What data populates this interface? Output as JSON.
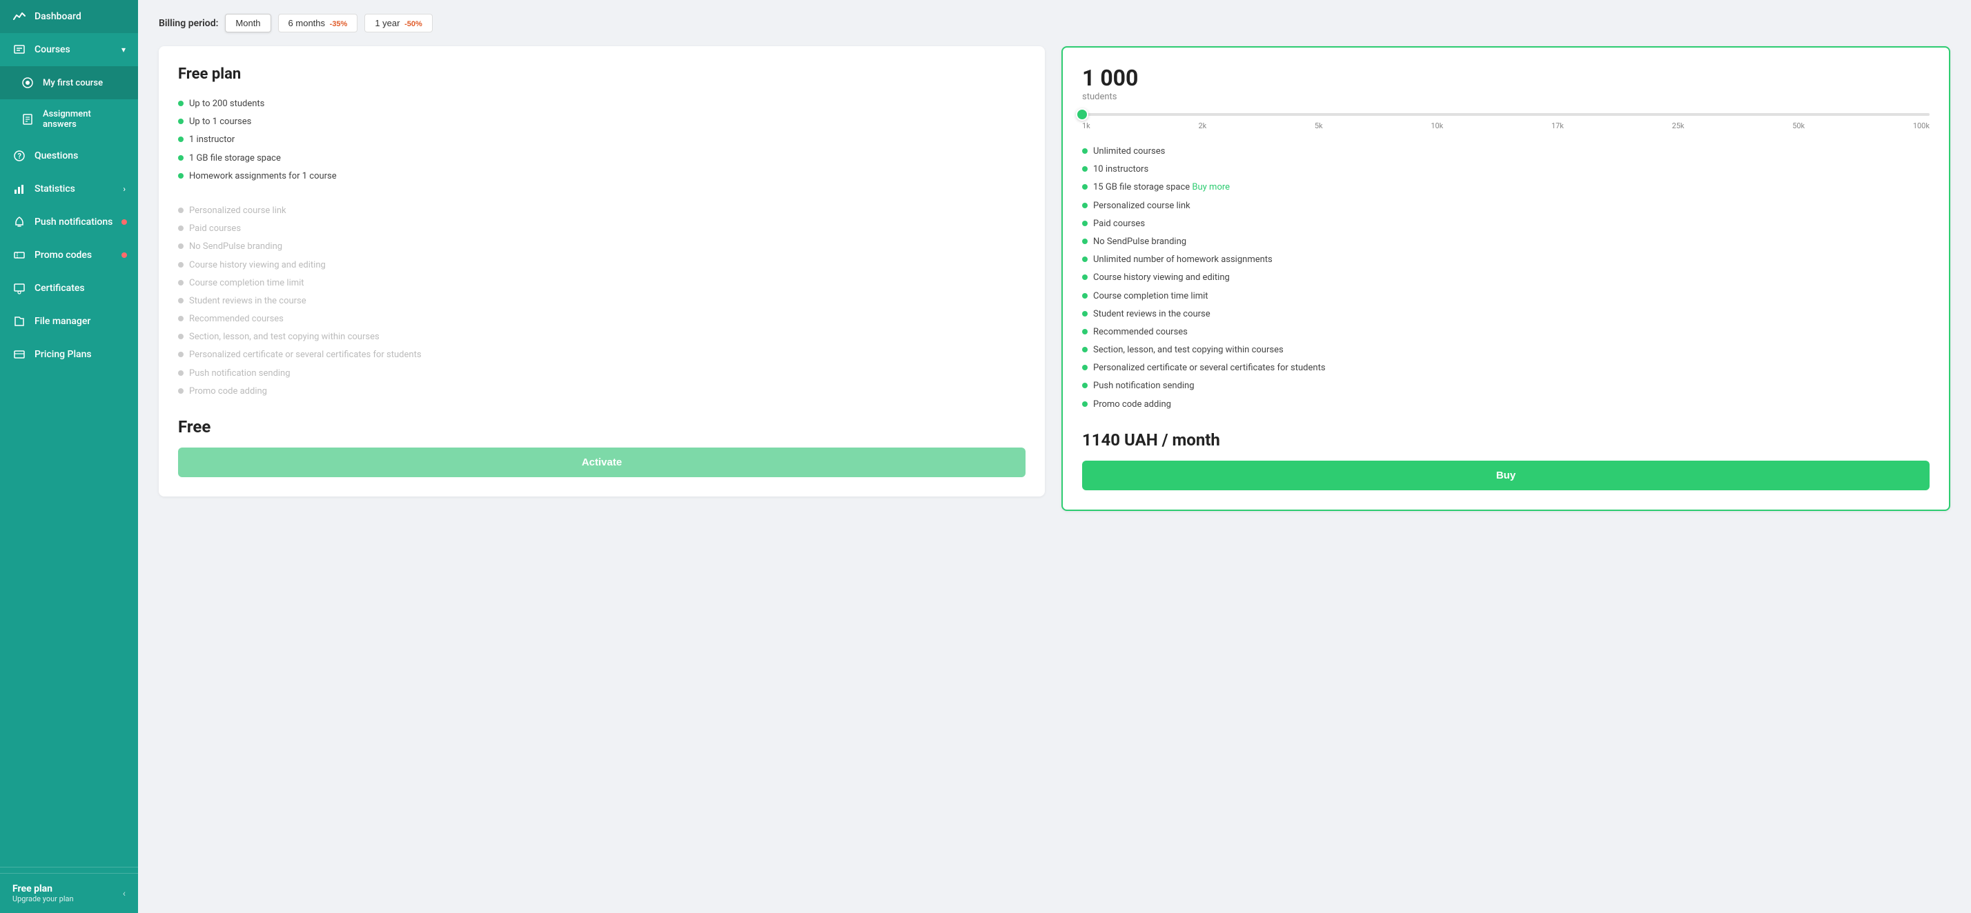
{
  "sidebar": {
    "items": [
      {
        "id": "dashboard",
        "label": "Dashboard",
        "icon": "chart-icon",
        "badge": false,
        "arrow": false
      },
      {
        "id": "courses",
        "label": "Courses",
        "icon": "courses-icon",
        "badge": false,
        "arrow": true
      },
      {
        "id": "my-first-course",
        "label": "My first course",
        "icon": "course-item-icon",
        "badge": false,
        "arrow": false
      },
      {
        "id": "assignment-answers",
        "label": "Assignment answers",
        "icon": "assignment-icon",
        "badge": false,
        "arrow": false
      },
      {
        "id": "questions",
        "label": "Questions",
        "icon": "questions-icon",
        "badge": false,
        "arrow": false
      },
      {
        "id": "statistics",
        "label": "Statistics",
        "icon": "statistics-icon",
        "badge": false,
        "arrow": true
      },
      {
        "id": "push-notifications",
        "label": "Push notifications",
        "icon": "push-icon",
        "badge": true,
        "arrow": false
      },
      {
        "id": "promo-codes",
        "label": "Promo codes",
        "icon": "promo-icon",
        "badge": true,
        "arrow": false
      },
      {
        "id": "certificates",
        "label": "Certificates",
        "icon": "cert-icon",
        "badge": false,
        "arrow": false
      },
      {
        "id": "file-manager",
        "label": "File manager",
        "icon": "file-icon",
        "badge": false,
        "arrow": false
      },
      {
        "id": "pricing-plans",
        "label": "Pricing Plans",
        "icon": "pricing-icon",
        "badge": false,
        "arrow": false
      }
    ],
    "bottom": {
      "plan_name": "Free plan",
      "plan_sub": "Upgrade your plan",
      "collapse_icon": "‹"
    }
  },
  "billing": {
    "label": "Billing period:",
    "options": [
      {
        "id": "month",
        "label": "Month",
        "active": true,
        "discount": ""
      },
      {
        "id": "6months",
        "label": "6 months",
        "active": false,
        "discount": "-35%"
      },
      {
        "id": "1year",
        "label": "1 year",
        "active": false,
        "discount": "-50%"
      }
    ]
  },
  "free_plan": {
    "title": "Free plan",
    "features_active": [
      "Up to 200 students",
      "Up to 1 courses",
      "1 instructor",
      "1 GB file storage space",
      "Homework assignments for 1 course"
    ],
    "features_inactive": [
      "Personalized course link",
      "Paid courses",
      "No SendPulse branding",
      "Course history viewing and editing",
      "Course completion time limit",
      "Student reviews in the course",
      "Recommended courses",
      "Section, lesson, and test copying within courses",
      "Personalized certificate or several certificates for students",
      "Push notification sending",
      "Promo code adding"
    ],
    "price": "Free",
    "button_label": "Activate"
  },
  "paid_plan": {
    "students_count": "1 000",
    "students_label": "students",
    "slider_labels": [
      "1k",
      "2k",
      "5k",
      "10k",
      "17k",
      "25k",
      "50k",
      "100k"
    ],
    "slider_position_percent": 0,
    "features_active": [
      {
        "text": "Unlimited courses",
        "link": null
      },
      {
        "text": "10 instructors",
        "link": null
      },
      {
        "text": "15 GB file storage space",
        "link": null,
        "link_text": "Buy more"
      },
      {
        "text": "Personalized course link",
        "link": null
      },
      {
        "text": "Paid courses",
        "link": null
      },
      {
        "text": "No SendPulse branding",
        "link": null
      },
      {
        "text": "Unlimited number of homework assignments",
        "link": null
      },
      {
        "text": "Course history viewing and editing",
        "link": null
      },
      {
        "text": "Course completion time limit",
        "link": null
      },
      {
        "text": "Student reviews in the course",
        "link": null
      },
      {
        "text": "Recommended courses",
        "link": null
      },
      {
        "text": "Section, lesson, and test copying within courses",
        "link": null
      },
      {
        "text": "Personalized certificate or several certificates for students",
        "link": null
      },
      {
        "text": "Push notification sending",
        "link": null
      },
      {
        "text": "Promo code adding",
        "link": null
      }
    ],
    "price": "1140 UAH / month",
    "button_label": "Buy"
  }
}
